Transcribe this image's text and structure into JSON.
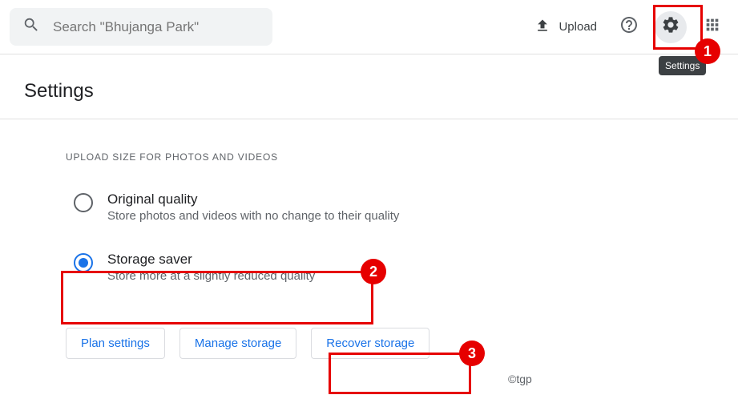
{
  "header": {
    "search_placeholder": "Search \"Bhujanga Park\"",
    "upload_label": "Upload",
    "tooltip": "Settings"
  },
  "page_title": "Settings",
  "section": {
    "label": "UPLOAD SIZE FOR PHOTOS AND VIDEOS",
    "options": [
      {
        "title": "Original quality",
        "desc": "Store photos and videos with no change to their quality",
        "selected": false
      },
      {
        "title": "Storage saver",
        "desc": "Store more at a slightly reduced quality",
        "selected": true
      }
    ]
  },
  "buttons": {
    "plan": "Plan settings",
    "manage": "Manage storage",
    "recover": "Recover storage"
  },
  "callouts": {
    "one": "1",
    "two": "2",
    "three": "3"
  },
  "copyright": "©tgp"
}
